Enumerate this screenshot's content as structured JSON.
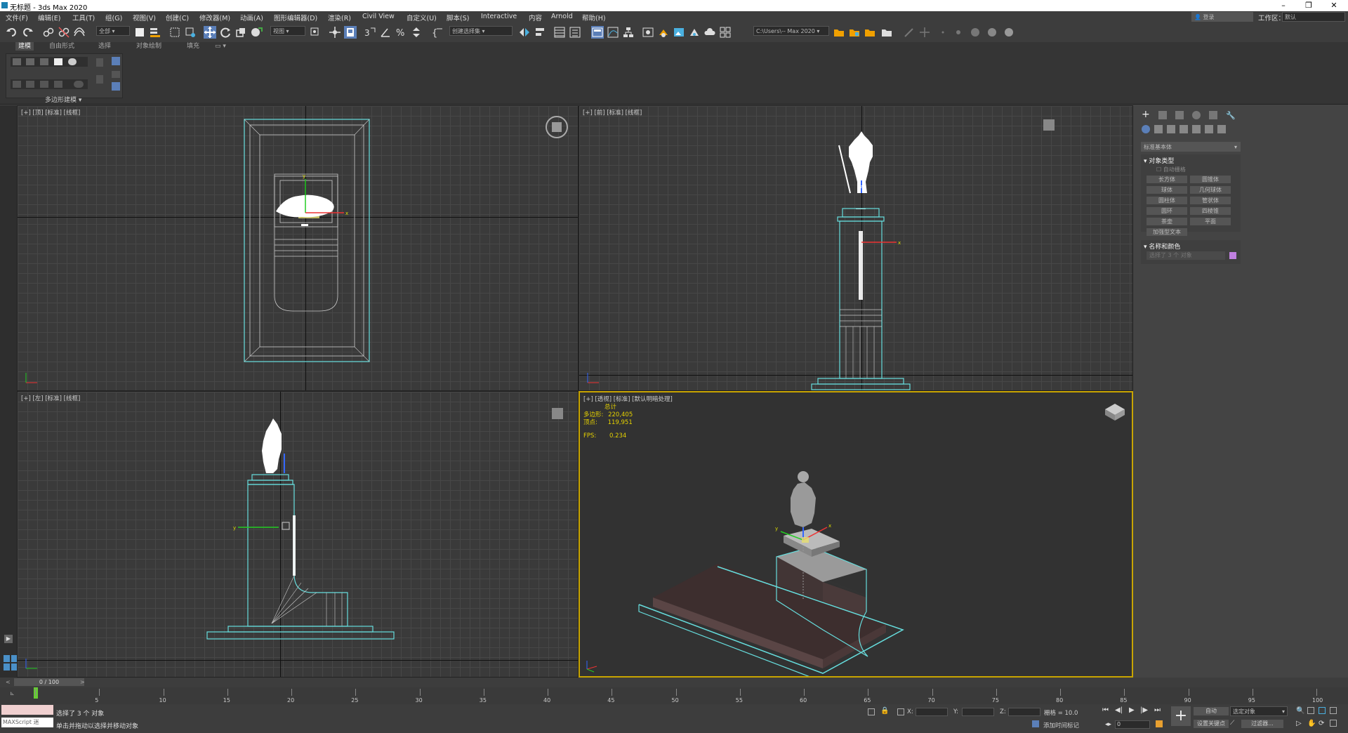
{
  "window": {
    "title": "无标题 - 3ds Max 2020"
  },
  "menu": [
    "文件(F)",
    "编辑(E)",
    "工具(T)",
    "组(G)",
    "视图(V)",
    "创建(C)",
    "修改器(M)",
    "动画(A)",
    "图形编辑器(D)",
    "渲染(R)",
    "Civil View",
    "自定义(U)",
    "脚本(S)",
    "Interactive",
    "内容",
    "Arnold",
    "帮助(H)"
  ],
  "account": {
    "login": "登录",
    "workspace_label": "工作区：",
    "workspace_value": "默认"
  },
  "toolbar": {
    "filter": "全部",
    "ref_coord": "视图",
    "named_sel": "创建选择集",
    "project_path": "C:\\Users\\-- Max 2020"
  },
  "ribbon": {
    "tabs": [
      "建模",
      "自由形式",
      "选择",
      "对象绘制",
      "填充"
    ],
    "group_label": "多边形建模"
  },
  "viewports": {
    "top": {
      "label": "[+] [顶] [标准] [线框]"
    },
    "front": {
      "label": "[+] [前] [标准] [线框]"
    },
    "left": {
      "label": "[+] [左] [标准] [线框]"
    },
    "persp": {
      "label": "[+] [透视] [标准] [默认明暗处理]",
      "stats_total": "总计",
      "polys_label": "多边形:",
      "polys": "220,405",
      "verts_label": "顶点:",
      "verts": "119,951",
      "fps_label": "FPS:",
      "fps": "0.234"
    }
  },
  "command_panel": {
    "category": "标准基本体",
    "rollout_object_type": "对象类型",
    "autogrid": "自动栅格",
    "buttons": [
      "长方体",
      "圆锥体",
      "球体",
      "几何球体",
      "圆柱体",
      "管状体",
      "圆环",
      "四棱锥",
      "茶壶",
      "平面",
      "加强型文本"
    ],
    "rollout_name_color": "名称和颜色",
    "name_field": "选择了 3 个 对象"
  },
  "timeline": {
    "frame_display": "0 / 100",
    "ticks": [
      "0",
      "5",
      "10",
      "15",
      "20",
      "25",
      "30",
      "35",
      "40",
      "45",
      "50",
      "55",
      "60",
      "65",
      "70",
      "75",
      "80",
      "85",
      "90",
      "95",
      "100"
    ]
  },
  "status": {
    "script_label": "MAXScript 迷",
    "selected": "选择了 3 个 对象",
    "prompt": "单击并拖动以选择并移动对象",
    "x_label": "X:",
    "y_label": "Y:",
    "z_label": "Z:",
    "grid": "栅格 = 10.0",
    "add_time_tag": "添加时间标记",
    "auto_key": "自动",
    "selected_obj": "选定对象",
    "set_key": "设置关键点",
    "key_filter": "过滤器...",
    "frame": "0"
  }
}
